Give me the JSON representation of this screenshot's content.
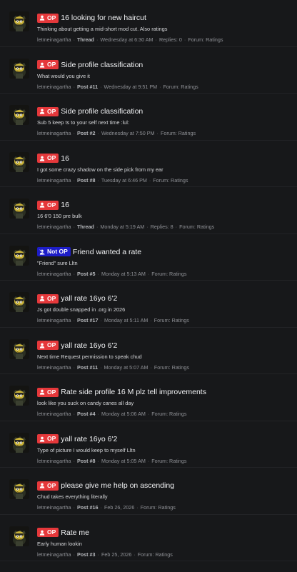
{
  "results": [
    {
      "badge": "OP",
      "badge_kind": "op",
      "title": "16 looking for new haircut",
      "snippet": "Thinking about getting a mid-short mod cut. Also ratings",
      "author": "letmeinagartha",
      "type": "Thread",
      "date": "Wednesday at 6:30 AM",
      "extra": "Replies: 0",
      "forum": "Forum: Ratings"
    },
    {
      "badge": "OP",
      "badge_kind": "op",
      "title": "Side profile classification",
      "snippet": "What would you give it",
      "author": "letmeinagartha",
      "type": "Post #11",
      "date": "Wednesday at 9:51 PM",
      "extra": "",
      "forum": "Forum: Ratings"
    },
    {
      "badge": "OP",
      "badge_kind": "op",
      "title": "Side profile classification",
      "snippet": "Sub 5 keep ts to your self next time :lul:",
      "author": "letmeinagartha",
      "type": "Post #2",
      "date": "Wednesday at 7:50 PM",
      "extra": "",
      "forum": "Forum: Ratings"
    },
    {
      "badge": "OP",
      "badge_kind": "op",
      "title": "16",
      "snippet": "I got some crazy shadow on the side pick from my ear",
      "author": "letmeinagartha",
      "type": "Post #8",
      "date": "Tuesday at 6:46 PM",
      "extra": "",
      "forum": "Forum: Ratings"
    },
    {
      "badge": "OP",
      "badge_kind": "op",
      "title": "16",
      "snippet": "16 6'0 150 pre bulk",
      "author": "letmeinagartha",
      "type": "Thread",
      "date": "Monday at 5:19 AM",
      "extra": "Replies: 8",
      "forum": "Forum: Ratings"
    },
    {
      "badge": "Not OP",
      "badge_kind": "notop",
      "title": "Friend wanted a rate",
      "snippet": "\"Friend\" sure Lltn",
      "author": "letmeinagartha",
      "type": "Post #5",
      "date": "Monday at 5:13 AM",
      "extra": "",
      "forum": "Forum: Ratings"
    },
    {
      "badge": "OP",
      "badge_kind": "op",
      "title": "yall rate 16yo 6'2",
      "snippet": "Js got double snapped in .org in 2026",
      "author": "letmeinagartha",
      "type": "Post #17",
      "date": "Monday at 5:11 AM",
      "extra": "",
      "forum": "Forum: Ratings"
    },
    {
      "badge": "OP",
      "badge_kind": "op",
      "title": "yall rate 16yo 6'2",
      "snippet": "Next time Request permission to speak chud",
      "author": "letmeinagartha",
      "type": "Post #11",
      "date": "Monday at 5:07 AM",
      "extra": "",
      "forum": "Forum: Ratings"
    },
    {
      "badge": "OP",
      "badge_kind": "op",
      "title": "Rate side profile 16 M plz tell improvements",
      "snippet": "look like you suck on candy canes all day",
      "author": "letmeinagartha",
      "type": "Post #4",
      "date": "Monday at 5:06 AM",
      "extra": "",
      "forum": "Forum: Ratings"
    },
    {
      "badge": "OP",
      "badge_kind": "op",
      "title": "yall rate 16yo 6'2",
      "snippet": "Type of picture I would keep to myself Lltn",
      "author": "letmeinagartha",
      "type": "Post #8",
      "date": "Monday at 5:05 AM",
      "extra": "",
      "forum": "Forum: Ratings"
    },
    {
      "badge": "OP",
      "badge_kind": "op",
      "title": "please give me help on ascending",
      "snippet": "Chud takes everything literally",
      "author": "letmeinagartha",
      "type": "Post #16",
      "date": "Feb 26, 2026",
      "extra": "",
      "forum": "Forum: Ratings"
    },
    {
      "badge": "OP",
      "badge_kind": "op",
      "title": "Rate me",
      "snippet": "Early human lookin",
      "author": "letmeinagartha",
      "type": "Post #3",
      "date": "Feb 25, 2026",
      "extra": "",
      "forum": "Forum: Ratings"
    }
  ],
  "meta_separator": "·",
  "icons": {
    "op_badge": "user-icon",
    "notop_badge": "user-slash-icon",
    "avatar": "cartoon-avatar-icon"
  },
  "colors": {
    "background": "#17181a",
    "op_badge": "#e5383b",
    "notop_badge": "#1d1dc8",
    "meta_text": "#8f9196"
  }
}
